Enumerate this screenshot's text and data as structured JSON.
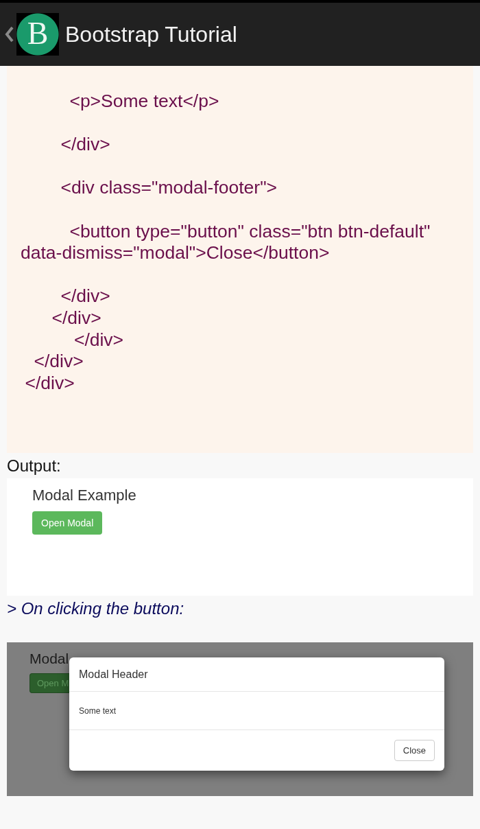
{
  "app_bar": {
    "logo_letter": "B",
    "title": "Bootstrap Tutorial"
  },
  "code_blocks": [
    {
      "lines": [
        "           <p>Some text</p>"
      ]
    },
    {
      "lines": [
        "         </div>"
      ]
    },
    {
      "lines": [
        "         <div class=\"modal-footer\">"
      ]
    },
    {
      "lines": [
        "           <button type=\"button\" class=\"btn btn-default\" data-dismiss=\"modal\">Close</button>"
      ]
    },
    {
      "lines": [
        "         </div>",
        "       </div>",
        "            </div>",
        "   </div>",
        " </div>"
      ]
    }
  ],
  "output_label": "Output:",
  "output_demo": {
    "heading": "Modal Example",
    "button": "Open Modal"
  },
  "note": "> On clicking the button:",
  "modal_demo": {
    "heading": "Modal",
    "button": "Open M",
    "dialog": {
      "title": "Modal Header",
      "body": "Some text",
      "close_button": "Close"
    }
  }
}
